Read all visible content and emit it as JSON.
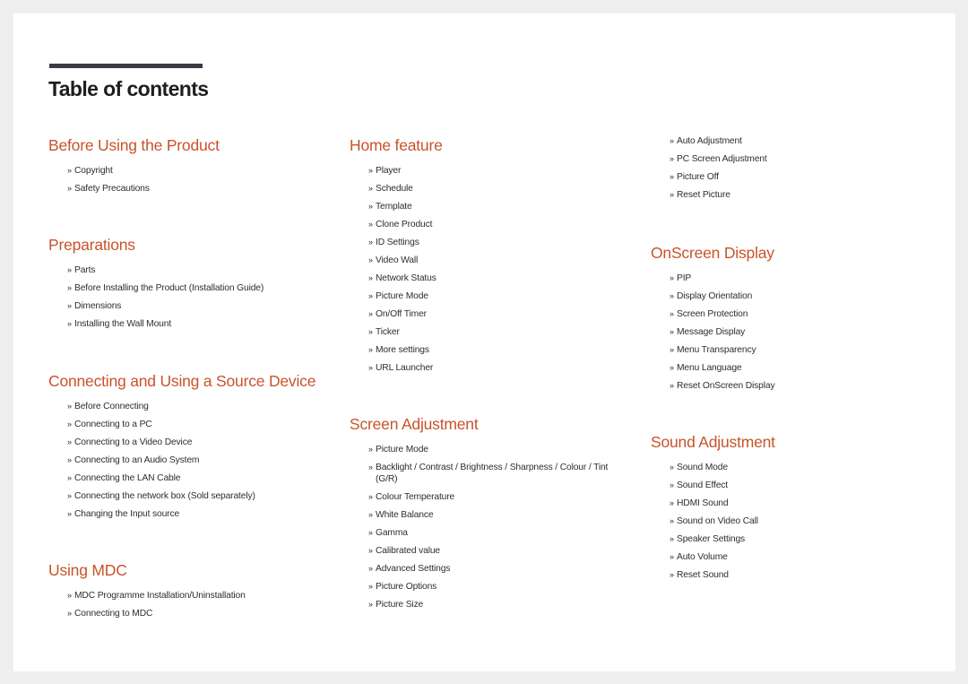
{
  "document": {
    "title": "Table of contents",
    "accent_color": "#c8532b",
    "title_bar_color": "#3c3b44",
    "bullet_glyph": "»"
  },
  "sections": [
    {
      "heading": "Before Using the Product",
      "items": [
        "Copyright",
        "Safety Precautions"
      ]
    },
    {
      "heading": "Preparations",
      "items": [
        "Parts",
        "Before Installing the Product (Installation Guide)",
        "Dimensions",
        "Installing the Wall Mount"
      ]
    },
    {
      "heading": "Connecting and Using a Source Device",
      "items": [
        "Before Connecting",
        "Connecting to a PC",
        "Connecting to a Video Device",
        "Connecting to an Audio System",
        "Connecting the LAN Cable",
        "Connecting the network box (Sold separately)",
        "Changing the Input source"
      ]
    },
    {
      "heading": "Using MDC",
      "items": [
        "MDC Programme Installation/Uninstallation",
        "Connecting to MDC"
      ]
    },
    {
      "heading": "Home feature",
      "items": [
        "Player",
        "Schedule",
        "Template",
        "Clone Product",
        "ID Settings",
        "Video Wall",
        "Network Status",
        "Picture Mode",
        "On/Off Timer",
        "Ticker",
        "More settings",
        "URL Launcher"
      ]
    },
    {
      "heading": "Screen Adjustment",
      "items": [
        "Picture Mode",
        "Backlight / Contrast / Brightness / Sharpness / Colour / Tint (G/R)",
        "Colour Temperature",
        "White Balance",
        "Gamma",
        "Calibrated value",
        "Advanced Settings",
        "Picture Options",
        "Picture Size"
      ]
    },
    {
      "heading": "",
      "continued_items": [
        "Auto Adjustment",
        "PC Screen Adjustment",
        "Picture Off",
        "Reset Picture"
      ]
    },
    {
      "heading": "OnScreen Display",
      "items": [
        "PIP",
        "Display Orientation",
        "Screen Protection",
        "Message Display",
        "Menu Transparency",
        "Menu Language",
        "Reset OnScreen Display"
      ]
    },
    {
      "heading": "Sound Adjustment",
      "items": [
        "Sound Mode",
        "Sound Effect",
        "HDMI Sound",
        "Sound on Video Call",
        "Speaker Settings",
        "Auto Volume",
        "Reset Sound"
      ]
    }
  ]
}
